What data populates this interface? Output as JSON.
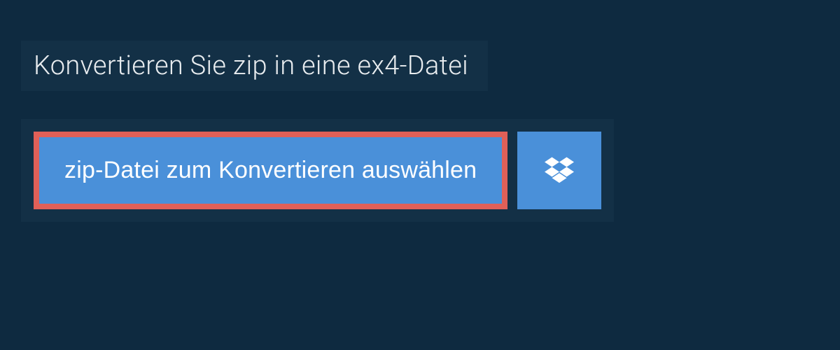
{
  "heading": {
    "text": "Konvertieren Sie zip in eine ex4-Datei"
  },
  "buttons": {
    "select_file_label": "zip-Datei zum Konvertieren auswählen",
    "dropbox_icon_name": "dropbox-icon"
  },
  "colors": {
    "background": "#0e2a40",
    "panel": "#133046",
    "button_primary": "#4a90d9",
    "button_border_highlight": "#e06058",
    "text": "#e8ecef",
    "button_text": "#ffffff"
  }
}
